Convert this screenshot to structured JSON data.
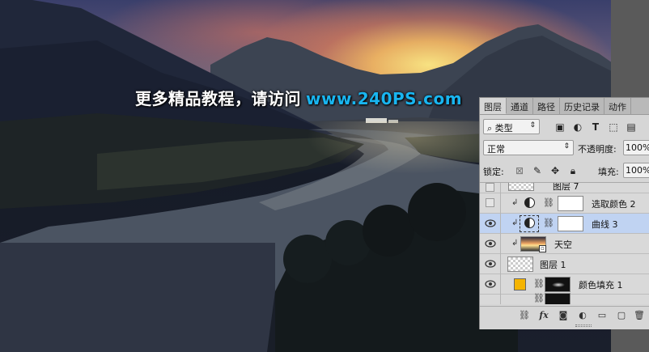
{
  "watermark": {
    "text": "更多精品教程，请访问",
    "site": "www.240PS.com"
  },
  "panel": {
    "tabs": [
      {
        "label": "图层",
        "active": true
      },
      {
        "label": "通道",
        "active": false
      },
      {
        "label": "路径",
        "active": false
      },
      {
        "label": "历史记录",
        "active": false
      },
      {
        "label": "动作",
        "active": false
      }
    ],
    "filter_kind": "类型",
    "blend_mode": "正常",
    "opacity_label": "不透明度:",
    "opacity_value": "100%",
    "lock_label": "锁定:",
    "fill_label": "填充:",
    "fill_value": "100%",
    "layers": [
      {
        "name": "图层 7",
        "visible": false,
        "kind": "pixel"
      },
      {
        "name": "选取颜色 2",
        "visible": false,
        "kind": "adjustment",
        "clipped": true
      },
      {
        "name": "曲线 3",
        "visible": true,
        "kind": "adjustment",
        "clipped": true,
        "selected": true
      },
      {
        "name": "天空",
        "visible": true,
        "kind": "smart",
        "clipped": true
      },
      {
        "name": "图层 1",
        "visible": true,
        "kind": "pixel"
      },
      {
        "name": "颜色填充 1",
        "visible": true,
        "kind": "fill",
        "fill_color": "#f5b400"
      }
    ]
  },
  "colors": {
    "selection": "#c0d3f2",
    "watermark_site": "#19b5f0"
  }
}
